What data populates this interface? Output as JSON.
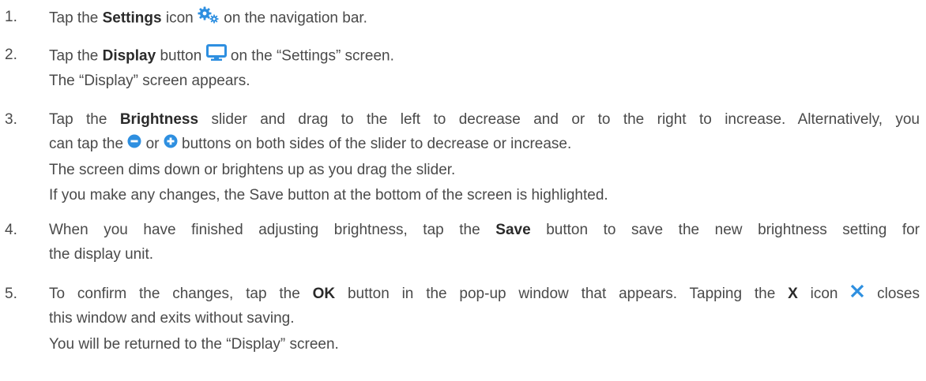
{
  "steps": [
    {
      "num": "1.",
      "a": "Tap the ",
      "b": "Settings",
      "c": " icon ",
      "d": " on the navigation bar.",
      "icon": "gears-icon"
    },
    {
      "num": "2.",
      "a": "Tap the ",
      "b": "Display",
      "c": " button ",
      "d": " on the “Settings” screen.",
      "icon": "monitor-icon",
      "note": "The “Display” screen appears."
    },
    {
      "num": "3.",
      "a": "Tap the ",
      "b": "Brightness",
      "c": " slider and drag to the left to decrease and or to the right to increase. Alternatively, you",
      "line2a": "can tap the ",
      "line2b": " or ",
      "line2c": " buttons on both sides of the slider to decrease or increase.",
      "note1": "The screen dims down or brightens up as you drag the slider.",
      "note2": "If you make any changes, the Save button at the bottom of the screen is highlighted.",
      "icons": [
        "minus-circle-icon",
        "plus-circle-icon"
      ]
    },
    {
      "num": "4.",
      "a": "When you have finished adjusting brightness, tap the ",
      "b": "Save",
      "c": " button to save the new brightness setting for",
      "line2": "the display unit."
    },
    {
      "num": "5.",
      "a": "To confirm the changes, tap the ",
      "b": "OK",
      "c": " button in the pop-up window that appears. Tapping the ",
      "d": "X",
      "e": " icon ",
      "f": " closes",
      "icon": "close-x-icon",
      "line2": "this window and exits without saving.",
      "note": "You will be returned to the “Display” screen."
    }
  ],
  "colors": {
    "accent": "#2e8fe0",
    "text": "#4a4a4a"
  }
}
